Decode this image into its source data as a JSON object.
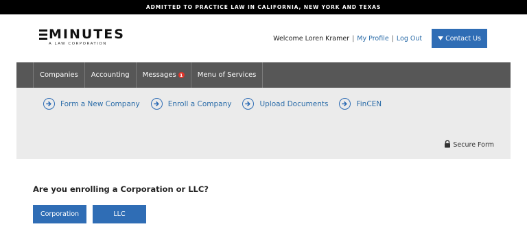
{
  "banner": {
    "text": "ADMITTED TO PRACTICE LAW IN CALIFORNIA, NEW YORK AND TEXAS"
  },
  "logo": {
    "name": "MINUTES",
    "tagline": "A LAW CORPORATION"
  },
  "header": {
    "welcome": "Welcome Loren Kramer",
    "separator": "|",
    "my_profile": "My Profile",
    "log_out": "Log Out",
    "contact_us": "Contact Us"
  },
  "nav": {
    "items": [
      {
        "label": "Companies"
      },
      {
        "label": "Accounting"
      },
      {
        "label": "Messages",
        "badge": "1"
      },
      {
        "label": "Menu of Services"
      }
    ]
  },
  "quick_links": [
    {
      "label": "Form a New Company",
      "icon": "arrow-right-circle-icon"
    },
    {
      "label": "Enroll a Company",
      "icon": "arrow-right-circle-icon"
    },
    {
      "label": "Upload Documents",
      "icon": "arrow-right-circle-icon"
    },
    {
      "label": "FinCEN",
      "icon": "arrow-right-circle-icon"
    }
  ],
  "secure": {
    "label": "Secure Form",
    "icon": "lock-icon"
  },
  "form": {
    "question": "Are you enrolling a Corporation or LLC?",
    "options": [
      "Corporation",
      "LLC"
    ]
  },
  "colors": {
    "accent": "#2f6db5",
    "nav_bg": "#575757",
    "subnav_bg": "#ebebeb",
    "badge": "#e0352b"
  }
}
